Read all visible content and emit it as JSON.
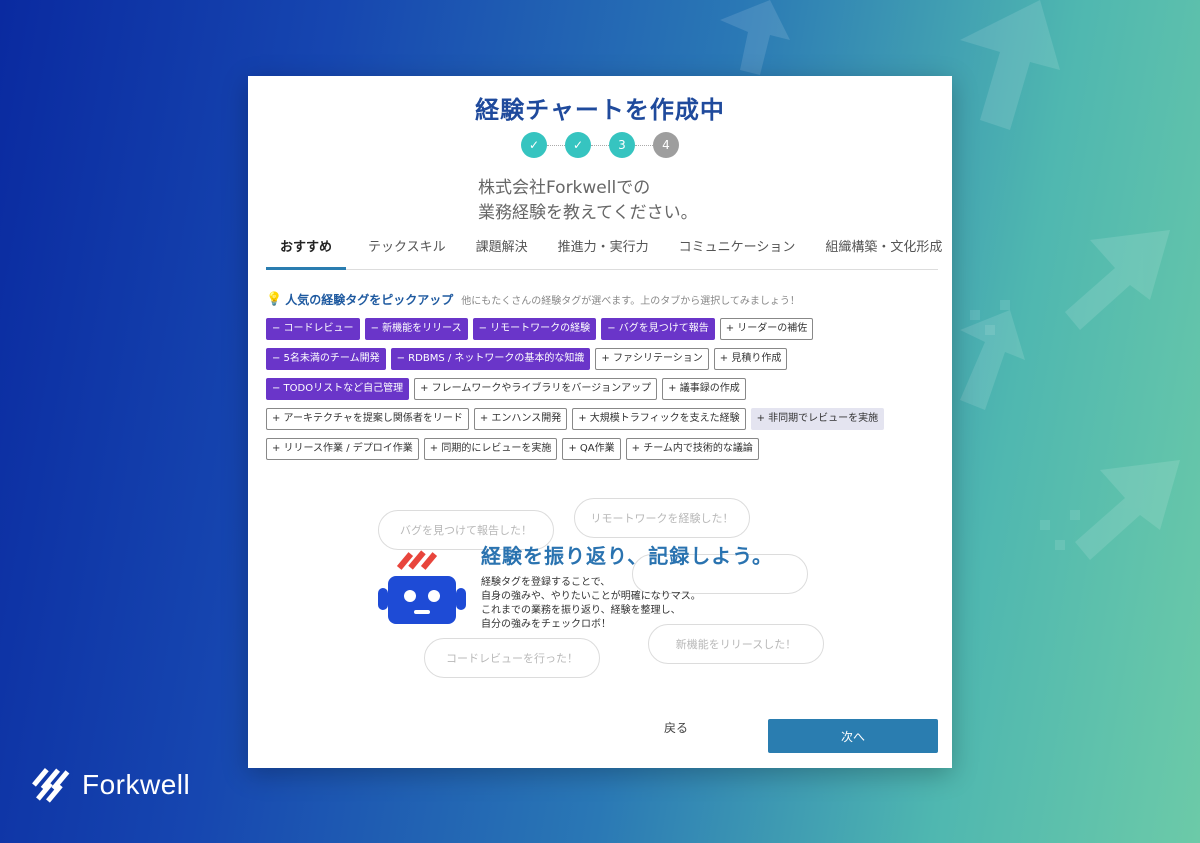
{
  "title": "経験チャートを作成中",
  "steps": [
    {
      "label": "✓",
      "state": "done"
    },
    {
      "label": "✓",
      "state": "done"
    },
    {
      "label": "3",
      "state": "current"
    },
    {
      "label": "4",
      "state": "todo"
    }
  ],
  "question": {
    "line1": "株式会社Forkwellでの",
    "line2": "業務経験を教えてください。"
  },
  "tabs": [
    "おすすめ",
    "テックスキル",
    "課題解決",
    "推進力・実行力",
    "コミュニケーション",
    "組織構築・文化形成"
  ],
  "pickup": {
    "title": "人気の経験タグをピックアップ",
    "subtitle": "他にもたくさんの経験タグが選べます。上のタブから選択してみましょう！"
  },
  "tag_rows": [
    [
      "− コードレビュー",
      "− 新機能をリリース",
      "− リモートワークの経験",
      "− バグを見つけて報告",
      "+ リーダーの補佐"
    ],
    [
      "− 5名未満のチーム開発",
      "− RDBMS / ネットワークの基本的な知識",
      "+ ファシリテーション",
      "+ 見積り作成"
    ],
    [
      "− TODOリストなど自己管理",
      "+ フレームワークやライブラリをバージョンアップ",
      "+ 議事録の作成"
    ],
    [
      "+ アーキテクチャを提案し関係者をリード",
      "+ エンハンス開発",
      "+ 大規模トラフィックを支えた経験",
      "+ 非同期でレビューを実施"
    ],
    [
      "+ リリース作業 / デプロイ作業",
      "+ 同期的にレビューを実施",
      "+ QA作業",
      "+ チーム内で技術的な議論"
    ]
  ],
  "illustration": {
    "bubbles": [
      "バグを見つけて報告した！",
      "リモートワークを経験した！",
      "コードレビューを行った！",
      "新機能をリリースした！"
    ],
    "heading": "経験を振り返り、記録しよう。",
    "text": [
      "経験タグを登録することで、",
      "自身の強みや、やりたいことが明確になりマス。",
      "これまでの業務を振り返り、経験を整理し、",
      "自分の強みをチェックロボ！"
    ]
  },
  "buttons": {
    "back": "戻る",
    "next": "次へ"
  },
  "brand": "Forkwell",
  "colors": {
    "accent": "#2a7db0",
    "selected_tag": "#6a35c9",
    "step": "#36c4c0"
  }
}
